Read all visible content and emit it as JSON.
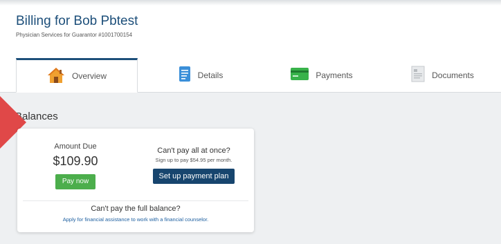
{
  "header": {
    "title": "Billing for Bob Pbtest",
    "subtitle": "Physician Services for Guarantor #1001700154"
  },
  "tabs": [
    {
      "label": "Overview",
      "icon": "house-icon",
      "active": true
    },
    {
      "label": "Details",
      "icon": "document-list-icon",
      "active": false
    },
    {
      "label": "Payments",
      "icon": "credit-card-icon",
      "active": false
    },
    {
      "label": "Documents",
      "icon": "documents-icon",
      "active": false
    }
  ],
  "balances": {
    "section_title": "Balances",
    "amount_label": "Amount Due",
    "amount": "$109.90",
    "pay_now_label": "Pay now",
    "cant_pay_all": "Can't pay all at once?",
    "signup_text": "Sign up to pay $54.95 per month.",
    "plan_button_label": "Set up payment plan",
    "cant_pay_full": "Can't pay the full balance?",
    "assistance_link": "Apply for financial assistance to work with a financial counselor."
  },
  "colors": {
    "brand": "#1d4f7a",
    "pay_now": "#4cae4c",
    "plan_button": "#17456e",
    "arrow": "#e04848"
  }
}
